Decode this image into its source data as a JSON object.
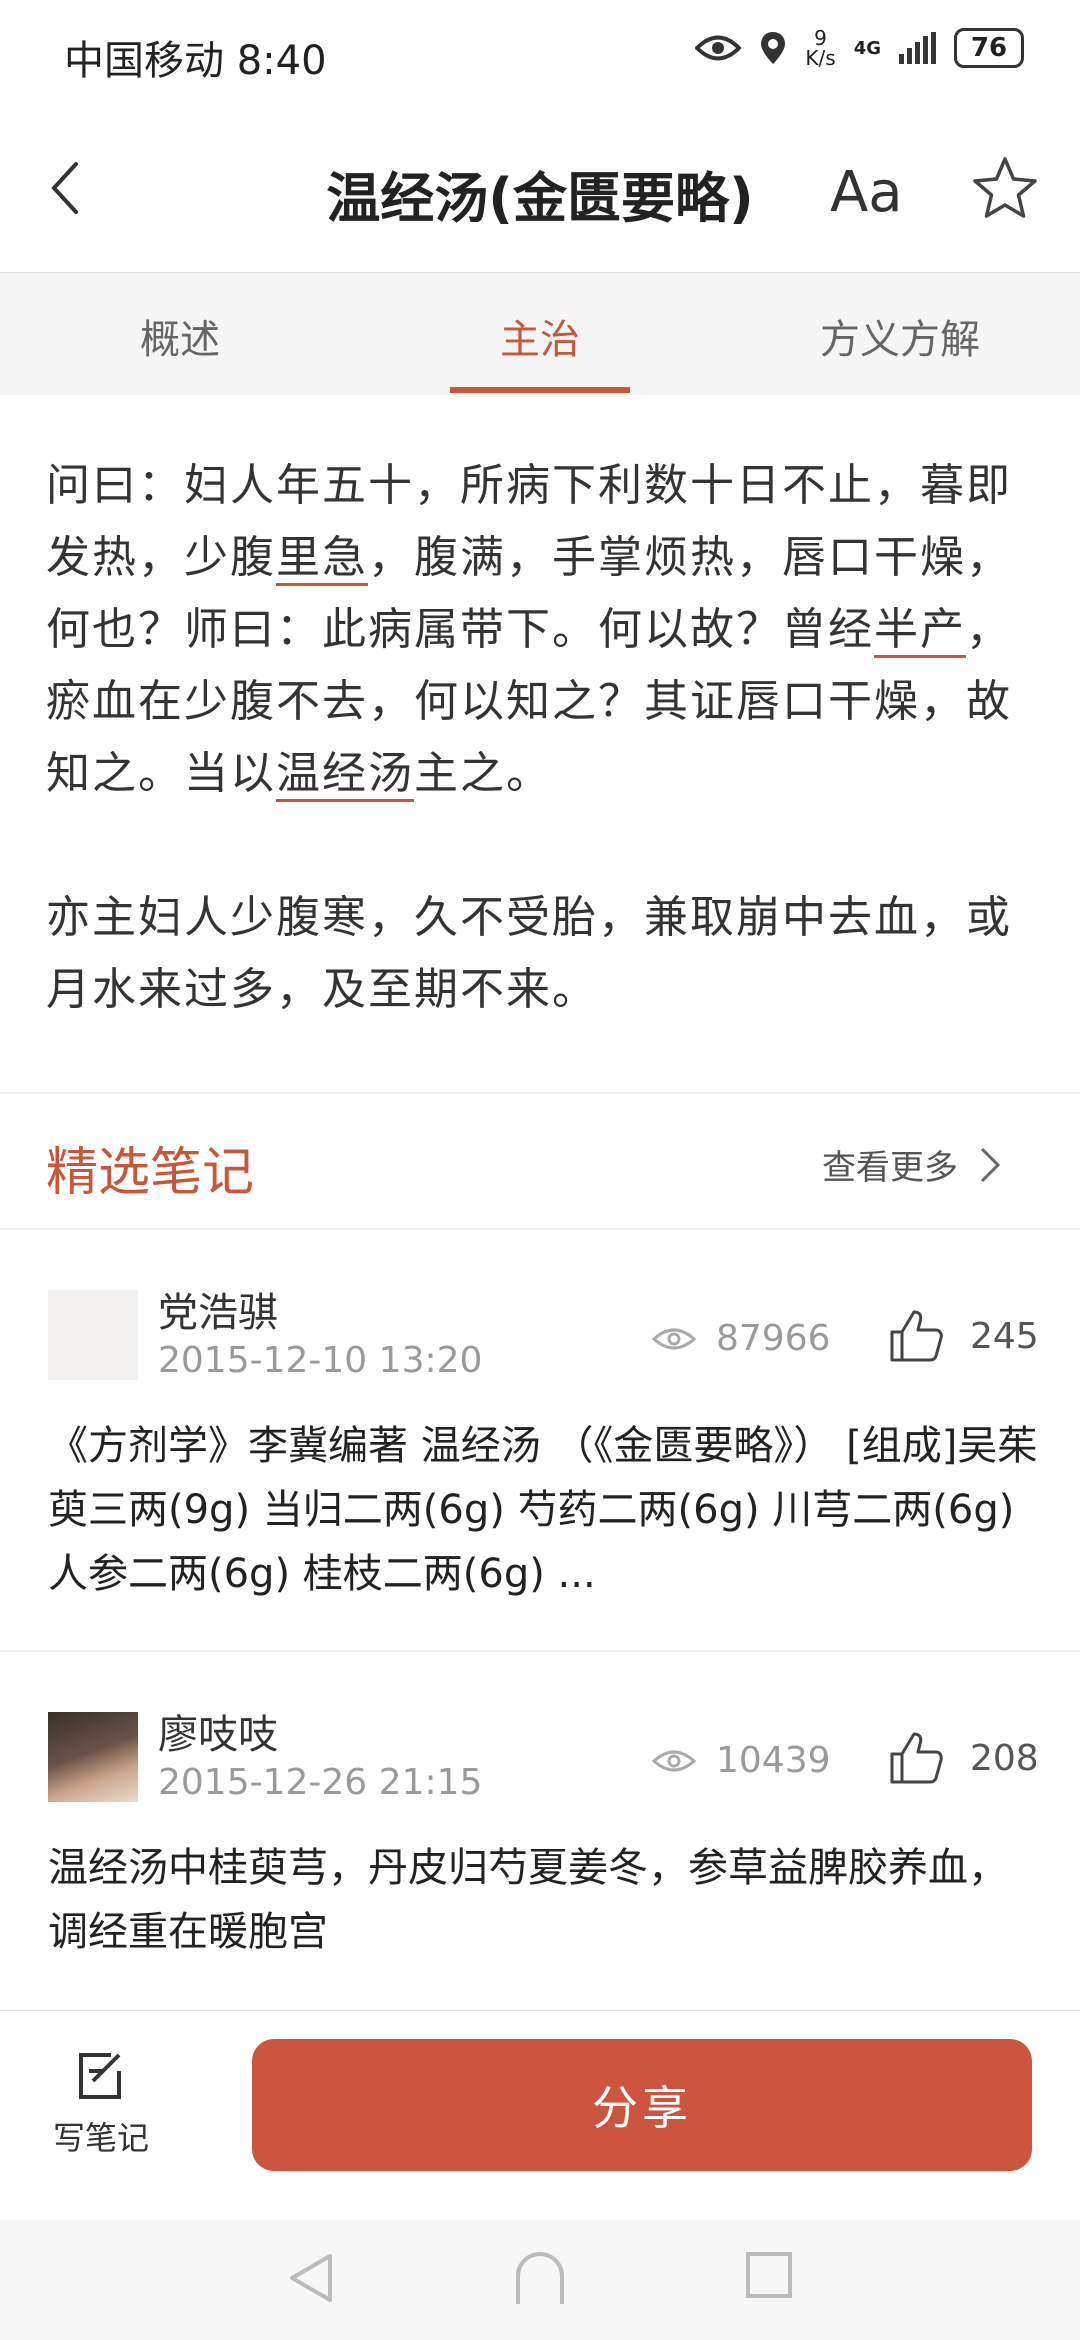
{
  "status_bar": {
    "carrier_time": "中国移动 8:40",
    "speed_value": "9",
    "speed_unit": "K/s",
    "network": "4G",
    "battery": "76"
  },
  "header": {
    "title": "温经汤(金匮要略)",
    "font_label": "Aa"
  },
  "tabs": [
    {
      "label": "概述"
    },
    {
      "label": "主治"
    },
    {
      "label": "方义方解"
    }
  ],
  "main": {
    "p1": [
      {
        "text": "问曰：妇人年五十，所病下利数十日不止，暮即发热，少腹"
      },
      {
        "text": "里急",
        "link": true
      },
      {
        "text": "，腹满，手掌烦热，唇口干燥，何也？师曰：此病属带下。何以故？曾经"
      },
      {
        "text": "半产",
        "link": true
      },
      {
        "text": "，瘀血在少腹不去，何以知之？其证唇口干燥，故知之。当以"
      },
      {
        "text": "温经汤",
        "link": true
      },
      {
        "text": "主之。"
      }
    ],
    "p2": "亦主妇人少腹寒，久不受胎，兼取崩中去血，或月水来过多，及至期不来。"
  },
  "notes": {
    "title": "精选笔记",
    "more": "查看更多",
    "items": [
      {
        "name": "党浩骐",
        "date": "2015-12-10 13:20",
        "views": "87966",
        "likes": "245",
        "text": "《方剂学》李冀编著 温经汤 （《金匮要略》） [组成]吴茱萸三两(9g) 当归二两(6g) 芍药二两(6g) 川芎二两(6g) 人参二两(6g) 桂枝二两(6g) ..."
      },
      {
        "name": "廖吱吱",
        "date": "2015-12-26 21:15",
        "views": "10439",
        "likes": "208",
        "text": "温经汤中桂萸芎，丹皮归芍夏姜冬，参草益脾胶养血，调经重在暖胞宫"
      }
    ]
  },
  "bottom": {
    "write_label": "写笔记",
    "share_label": "分享"
  },
  "colors": {
    "accent": "#c4583a",
    "share_button": "#cc5540"
  }
}
